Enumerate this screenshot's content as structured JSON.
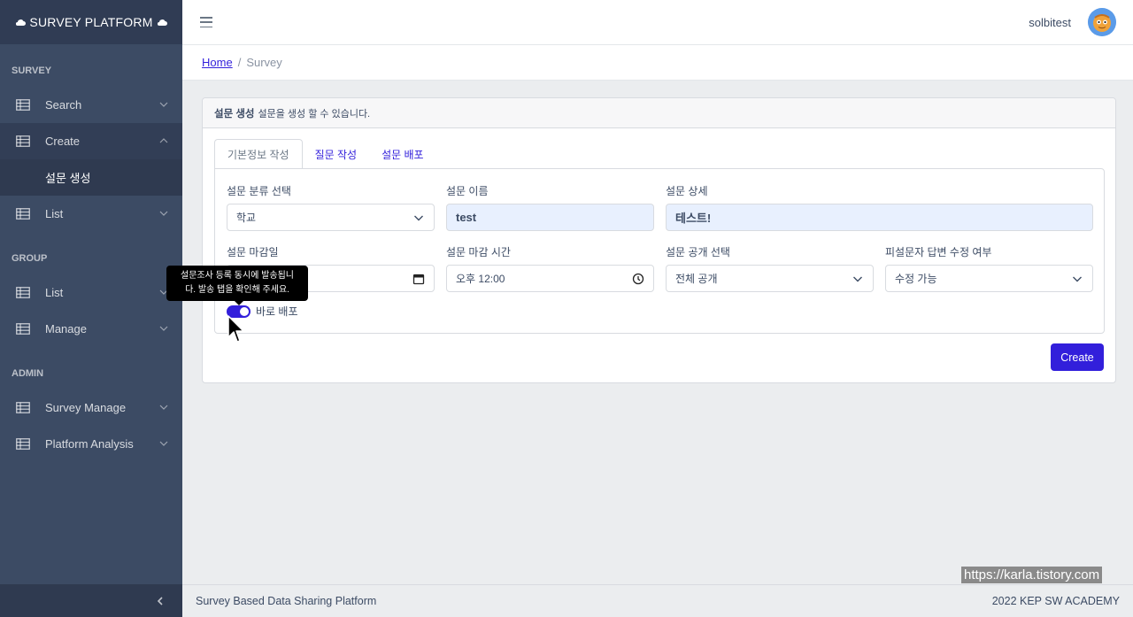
{
  "brand": {
    "title": "SURVEY PLATFORM"
  },
  "sidebar": {
    "sections": [
      {
        "title": "SURVEY"
      },
      {
        "title": "GROUP"
      },
      {
        "title": "ADMIN"
      }
    ],
    "items": {
      "survey_search": "Search",
      "survey_create": "Create",
      "survey_create_sub": "설문 생성",
      "survey_list": "List",
      "group_list": "List",
      "group_manage": "Manage",
      "admin_survey_manage": "Survey Manage",
      "admin_platform_analysis": "Platform Analysis"
    }
  },
  "header": {
    "username": "solbitest"
  },
  "breadcrumb": {
    "home": "Home",
    "separator": "/",
    "current": "Survey"
  },
  "card": {
    "header_title": "설문 생성",
    "header_desc": "설문을 생성 할 수 있습니다.",
    "tabs": [
      "기본정보 작성",
      "질문 작성",
      "설문 배포"
    ],
    "fields": {
      "category_label": "설문 분류 선택",
      "category_value": "학교",
      "name_label": "설문 이름",
      "name_value": "test",
      "detail_label": "설문 상세",
      "detail_value": "테스트!",
      "deadline_label": "설문 마감일",
      "deadline_time_label": "설문 마감 시간",
      "deadline_time_value": "오후 12:00",
      "visibility_label": "설문 공개 선택",
      "visibility_value": "전체 공개",
      "editable_label": "피설문자 답변 수정 여부",
      "editable_value": "수정 가능"
    },
    "toggle_label": "바로 배포",
    "create_button": "Create"
  },
  "tooltip": {
    "line1": "설문조사 등록 동시에 발송됩니",
    "line2": "다. 발송 탭을 확인해 주세요."
  },
  "footer": {
    "left": "Survey Based Data Sharing Platform",
    "right": "2022 KEP SW ACADEMY"
  },
  "watermark": "https://karla.tistory.com",
  "colors": {
    "sidebar": "#3c4b64",
    "accent": "#321fdb",
    "background": "#ebedef"
  }
}
